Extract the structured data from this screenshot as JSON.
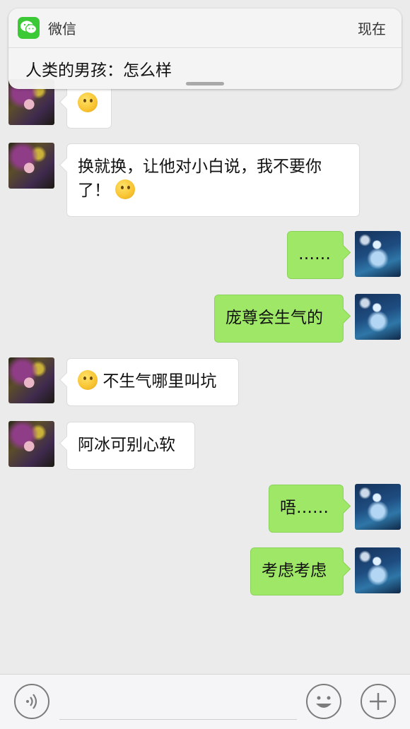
{
  "notification": {
    "app_name": "微信",
    "time": "现在",
    "message": "人类的男孩：怎么样"
  },
  "messages": [
    {
      "side": "left",
      "text": "",
      "emoji": "thinking-face"
    },
    {
      "side": "left",
      "text_line1": "换就换，让他对小白说，我不要你",
      "text_line2": "了！",
      "emoji": "rolling-eyes-face"
    },
    {
      "side": "right",
      "text": "……"
    },
    {
      "side": "right",
      "text": "庞尊会生气的"
    },
    {
      "side": "left",
      "text": "不生气哪里叫坑",
      "emoji": "smirking-face"
    },
    {
      "side": "left",
      "text": "阿冰可别心软"
    },
    {
      "side": "right",
      "text": "唔……"
    },
    {
      "side": "right",
      "text": "考虑考虑"
    }
  ],
  "input_bar": {
    "voice_icon": "voice-icon",
    "emoji_icon": "smile-icon",
    "add_icon": "plus-icon"
  },
  "colors": {
    "outgoing_bubble": "#9fe867",
    "incoming_bubble": "#ffffff",
    "background": "#ebebeb",
    "wechat_green": "#3bc936"
  }
}
